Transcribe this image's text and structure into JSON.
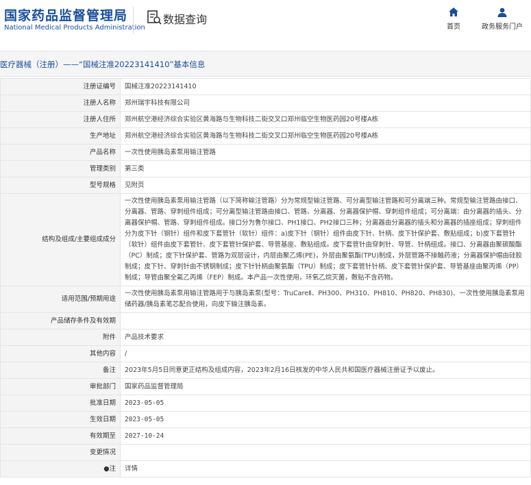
{
  "header": {
    "logo_cn": "国家药品监督管理局",
    "logo_en": "National Medical Products Administration",
    "query_title": "数据查询",
    "nav": [
      {
        "label": "首页",
        "icon": "home-icon"
      },
      {
        "label": "政务服务门户",
        "icon": "user-icon"
      }
    ]
  },
  "breadcrumb": "医疗器械（注册）——“国械注准20223141410”基本信息",
  "rows": [
    {
      "label": "注册证编号",
      "value": "国械注准20223141410"
    },
    {
      "label": "注册人名称",
      "value": "郑州瑞宇科技有限公司"
    },
    {
      "label": "注册人住所",
      "value": "郑州航空港经济综合实验区黄海路与生物科技二街交叉口郑州临空生物医药园20号楼A栋"
    },
    {
      "label": "生产地址",
      "value": "郑州航空港经济综合实验区黄海路与生物科技二街交叉口郑州临空生物医药园20号楼A栋"
    },
    {
      "label": "产品名称",
      "value": "一次性使用胰岛素泵用输注管路"
    },
    {
      "label": "管理类别",
      "value": "第三类"
    },
    {
      "label": "型号规格",
      "value": "见附页"
    },
    {
      "label": "结构及组成/主要组成成分",
      "value": "一次性使用胰岛素泵用输注管路（以下简称输注管路）分为常规型输注管路、可分离型输注管路和可分离端三种。常规型输注管路由接口、分离器、管路、穿刺组件组成；可分离型输注管路由接口、管路、分离器、分离器保护帽、穿刺组件组成；可分离端：由分离器的插头、分离器保护帽、管路、穿刺组件组成。接口分为鲁尔接口、PH1接口、PH2接口三种；分离器由分离器的插头和分离器的插座组成；穿刺组件分为皮下针（钢针）组件和皮下套管针（软针）组件：a)皮下针（钢针）组件由皮下针、针柄、皮下针保护套、敷贴组成；b)皮下套管针（软针）组件由皮下套管针、皮下套管针保护套、导管基座、敷贴组成。皮下套管针由穿刺针、导管、针柄组成。接口、分离器由聚碳酸酯（PC）制成；皮下针保护套、管路为双层设计，内层由聚乙烯(PE)，外层由聚氨酯(TPU)制成，外层管路不接触药液；分离器保护帽由硅胶制成；皮下针、穿刺针由不锈钢制成；皮下针针柄由聚氨酯（TPU）制成；皮下套管针针柄、皮下套管针保护套、导管基座由聚丙烯（PP）制成；导管由聚全氟乙丙烯（FEP）制成。本产品一次性使用，环氧乙烷灭菌，敷贴不含药物。"
    },
    {
      "label": "适用范围/预期用途",
      "value": "一次性使用胰岛素泵用输注管路用于与胰岛素泵(型号：TruCareⅡ、PH300、PH310、PH810、PH820、PH830)、一次性使用胰岛素泵用储药器/胰岛素笔芯配合使用，向皮下输注胰岛素。"
    },
    {
      "label": "产品储存条件及有效期",
      "value": ""
    },
    {
      "label": "附件",
      "value": "产品技术要求"
    },
    {
      "label": "其他内容",
      "value": "/"
    },
    {
      "label": "备注",
      "value": "2023年5月5日同意更正结构及组成内容，2023年2月16日核发的中华人民共和国医疗器械注册证予以废止。"
    },
    {
      "label": "审批部门",
      "value": "国家药品监督管理局"
    },
    {
      "label": "批准日期",
      "value": "2023-05-05"
    },
    {
      "label": "生效日期",
      "value": "2023-05-05"
    },
    {
      "label": "有效期至",
      "value": "2027-10-24"
    },
    {
      "label": "变更情况",
      "value": ""
    },
    {
      "label": "●注",
      "value": "详情"
    }
  ]
}
